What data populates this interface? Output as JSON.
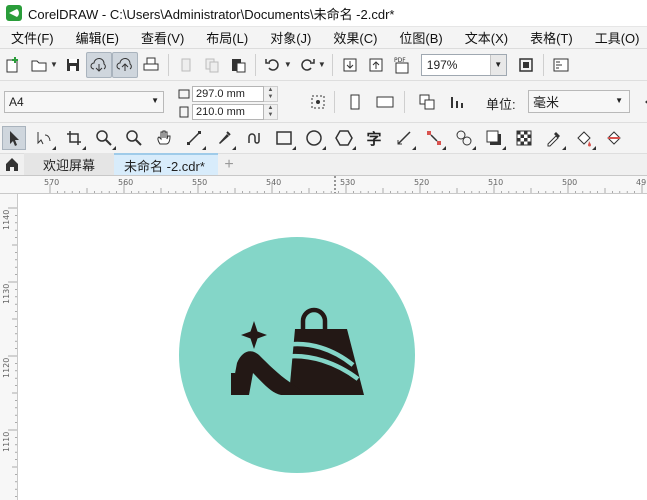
{
  "window": {
    "title": "CorelDRAW - C:\\Users\\Administrator\\Documents\\未命名 -2.cdr*"
  },
  "menu": [
    "文件(F)",
    "编辑(E)",
    "查看(V)",
    "布局(L)",
    "对象(J)",
    "效果(C)",
    "位图(B)",
    "文本(X)",
    "表格(T)",
    "工具(O)"
  ],
  "toolbar": {
    "zoom": "197%",
    "pdf_label": "PDF"
  },
  "property_bar": {
    "page_size": "A4",
    "width": "297.0 mm",
    "height": "210.0 mm",
    "unit_label": "单位:",
    "unit_value": "毫米"
  },
  "toolbox": {
    "text_tool_glyph": "字"
  },
  "tabs": {
    "welcome": "欢迎屏幕",
    "current": "未命名 -2.cdr*"
  },
  "ruler": {
    "h_labels": [
      "570",
      "560",
      "550",
      "540",
      "530",
      "520",
      "510",
      "500",
      "49"
    ],
    "v_labels": [
      "1140",
      "1130",
      "1120",
      "1110"
    ]
  },
  "artwork": {
    "circle_color": "#84d6c8",
    "icon_color": "#231815"
  }
}
